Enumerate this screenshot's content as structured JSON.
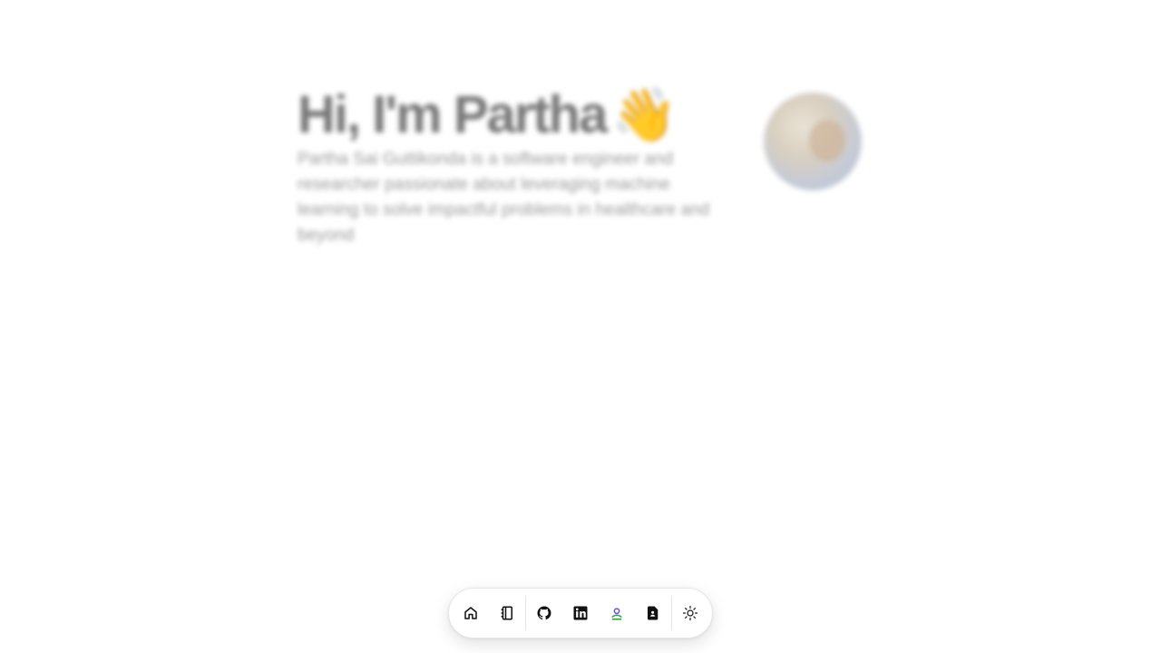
{
  "hero": {
    "title": "Hi, I'm Partha",
    "wave_emoji": "👋",
    "description": "Partha Sai Guttikonda is a software engineer and researcher passionate about leveraging machine learning to solve impactful problems in healthcare and beyond"
  },
  "dock": {
    "items": [
      {
        "icon": "home-icon"
      },
      {
        "icon": "notebook-icon"
      },
      {
        "icon": "github-icon"
      },
      {
        "icon": "linkedin-icon"
      },
      {
        "icon": "scholar-icon"
      },
      {
        "icon": "resume-icon"
      },
      {
        "icon": "sun-icon"
      }
    ]
  },
  "colors": {
    "accent_green": "#2f9e44",
    "accent_purple": "#7048e8"
  }
}
